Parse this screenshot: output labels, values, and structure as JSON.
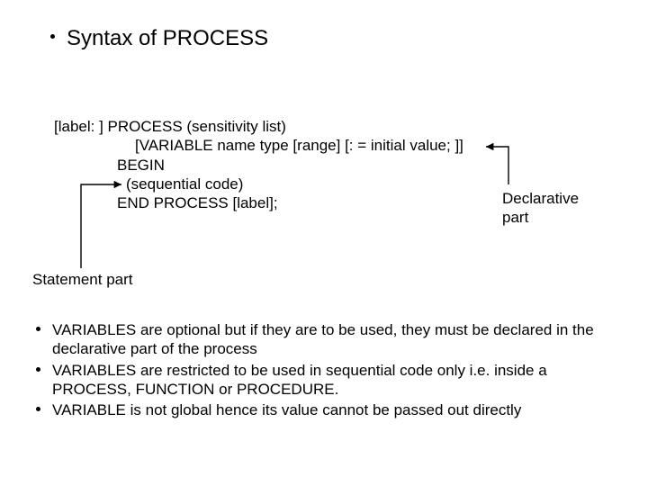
{
  "heading": "Syntax of PROCESS",
  "syntax": {
    "l1": "[label: ] PROCESS (sensitivity list)",
    "l2": "[VARIABLE name type [range] [: = initial value; ]]",
    "l3": "BEGIN",
    "l4": "(sequential code)",
    "l5": "END PROCESS [label];"
  },
  "labels": {
    "declarative1": "Declarative",
    "declarative2": "part",
    "statement": "Statement part"
  },
  "bullets": [
    "VARIABLES are optional but if they are to be used, they must be declared in the declarative part of the process",
    "VARIABLES are restricted to be used in sequential code only i.e. inside a PROCESS, FUNCTION or PROCEDURE.",
    "VARIABLE is not global hence its value cannot be passed out directly"
  ]
}
